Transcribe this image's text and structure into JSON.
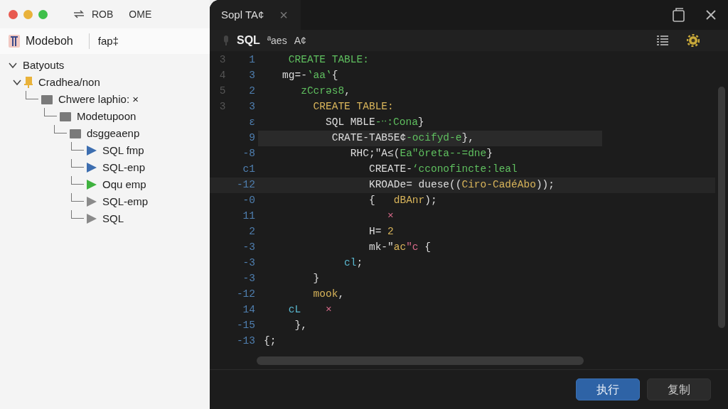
{
  "toolbar": {
    "items": [
      "ROB",
      "OME"
    ]
  },
  "sidebar": {
    "title": "Modeboh",
    "subtitle": "fap‡",
    "tree": [
      {
        "label": "Batyouts",
        "kind": "root",
        "expanded": true,
        "children": [
          {
            "label": "Cradhea/non",
            "kind": "bookmark",
            "expanded": true,
            "children": [
              {
                "label": "Chwere laphio: ×",
                "kind": "folder",
                "children": [
                  {
                    "label": "Modetupoon",
                    "kind": "folder",
                    "children": [
                      {
                        "label": "dsggeaenp",
                        "kind": "folder",
                        "children": [
                          {
                            "label": "SQL  fmp",
                            "kind": "query",
                            "color": "#3d6eb0"
                          },
                          {
                            "label": "SQL-enp",
                            "kind": "query",
                            "color": "#3d6eb0"
                          },
                          {
                            "label": "Oqu  emp",
                            "kind": "query",
                            "color": "#3fb23f"
                          },
                          {
                            "label": "SQL-emp",
                            "kind": "query",
                            "color": "#8a8a8a"
                          },
                          {
                            "label": "SQL",
                            "kind": "query",
                            "color": "#8a8a8a"
                          }
                        ]
                      }
                    ]
                  }
                ]
              }
            ]
          }
        ]
      }
    ]
  },
  "editor": {
    "tab": {
      "label": "Sopl TA¢",
      "close": "×"
    },
    "toolbar": [
      "SQL",
      "ªaes",
      "A¢"
    ],
    "lines": [
      {
        "gutter": "3",
        "num": "1",
        "tokens": [
          {
            "text": "    CREATE TABLE:",
            "kind": "string"
          }
        ]
      },
      {
        "gutter": "4",
        "num": "3",
        "tokens": [
          {
            "text": "   mg=-",
            "kind": "plain"
          },
          {
            "text": "‛aa‛",
            "kind": "string"
          },
          {
            "text": "{",
            "kind": "plain"
          }
        ]
      },
      {
        "gutter": "5",
        "num": "2",
        "tokens": [
          {
            "text": "      zCcrǝs8",
            "kind": "string"
          },
          {
            "text": ",",
            "kind": "plain"
          }
        ]
      },
      {
        "gutter": "3",
        "num": "3",
        "tokens": [
          {
            "text": "        CREATE TABLE:",
            "kind": "keyword"
          }
        ]
      },
      {
        "num": "ε",
        "tokens": [
          {
            "text": "          SQL MBLE",
            "kind": "plain"
          },
          {
            "text": "-ᐧᐧ:Cona",
            "kind": "string"
          },
          {
            "text": "}",
            "kind": "plain"
          }
        ]
      },
      {
        "num": "9",
        "selected": true,
        "tokens": [
          {
            "text": "           CRATE-TAB5E¢",
            "kind": "plain"
          },
          {
            "text": "-ocifyd-e",
            "kind": "string"
          },
          {
            "text": "},",
            "kind": "plain"
          }
        ]
      },
      {
        "num": "-8",
        "tokens": [
          {
            "text": "              RHC;\"A≤(",
            "kind": "plain"
          },
          {
            "text": "Ea\"öreta--=dne",
            "kind": "string"
          },
          {
            "text": "}",
            "kind": "plain"
          }
        ]
      },
      {
        "num": "c1",
        "tokens": [
          {
            "text": "                 CREATE-",
            "kind": "plain"
          },
          {
            "text": "‘cconofincte:leal",
            "kind": "string"
          }
        ]
      },
      {
        "num": "-12",
        "current": true,
        "tokens": [
          {
            "text": "                 KROADe= duese((",
            "kind": "plain"
          },
          {
            "text": "Ciro-CadéAbo",
            "kind": "keyword"
          },
          {
            "text": "));",
            "kind": "plain"
          }
        ]
      },
      {
        "num": "-0",
        "tokens": [
          {
            "text": "                 {   ",
            "kind": "plain"
          },
          {
            "text": "dBAnr",
            "kind": "keyword"
          },
          {
            "text": ");",
            "kind": "plain"
          }
        ]
      },
      {
        "num": "11",
        "tokens": [
          {
            "text": "                    ×",
            "kind": "error"
          }
        ]
      },
      {
        "num": "2",
        "tokens": [
          {
            "text": "                 H= ",
            "kind": "plain"
          },
          {
            "text": "2",
            "kind": "keyword"
          }
        ]
      },
      {
        "num": "-3",
        "tokens": [
          {
            "text": "                 mk-\"",
            "kind": "plain"
          },
          {
            "text": "ac",
            "kind": "keyword"
          },
          {
            "text": "\"c",
            "kind": "error"
          },
          {
            "text": " {",
            "kind": "plain"
          }
        ]
      },
      {
        "num": "-3",
        "tokens": [
          {
            "text": "             cl",
            "kind": "ident"
          },
          {
            "text": ";",
            "kind": "plain"
          }
        ]
      },
      {
        "num": "-3",
        "tokens": [
          {
            "text": "        }",
            "kind": "plain"
          }
        ]
      },
      {
        "num": "-12",
        "tokens": [
          {
            "text": "        mook",
            "kind": "keyword"
          },
          {
            "text": ",",
            "kind": "plain"
          }
        ]
      },
      {
        "num": "14",
        "tokens": [
          {
            "text": "    cL",
            "kind": "ident"
          },
          {
            "text": "    ×",
            "kind": "error"
          }
        ]
      },
      {
        "num": "-15",
        "tokens": [
          {
            "text": "     },",
            "kind": "plain"
          }
        ]
      },
      {
        "num": "-13",
        "tokens": [
          {
            "text": "{;",
            "kind": "plain"
          }
        ]
      }
    ]
  },
  "footer": {
    "buttons": [
      {
        "label": "执行",
        "kind": "primary"
      },
      {
        "label": "复制",
        "kind": "secondary"
      }
    ]
  }
}
